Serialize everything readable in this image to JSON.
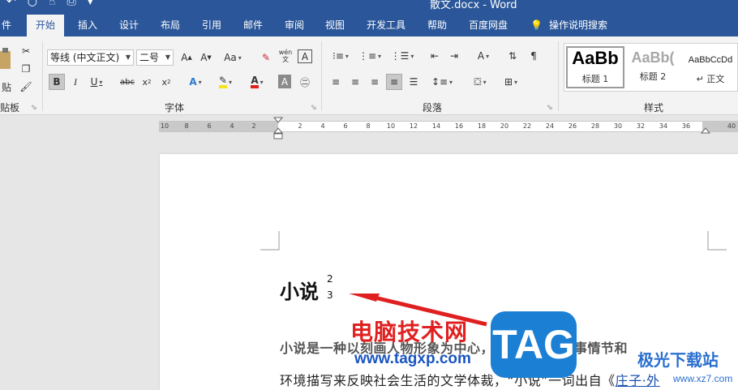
{
  "window": {
    "title": "散文.docx  -  Word"
  },
  "tabs": [
    {
      "label": "件"
    },
    {
      "label": "开始"
    },
    {
      "label": "插入"
    },
    {
      "label": "设计"
    },
    {
      "label": "布局"
    },
    {
      "label": "引用"
    },
    {
      "label": "邮件"
    },
    {
      "label": "审阅"
    },
    {
      "label": "视图"
    },
    {
      "label": "开发工具"
    },
    {
      "label": "帮助"
    },
    {
      "label": "百度网盘"
    },
    {
      "label": "操作说明搜索"
    }
  ],
  "ribbon": {
    "clipboard": {
      "paste_label": "贴",
      "group_label": "贴板"
    },
    "font": {
      "font_name": "等线 (中文正文)",
      "font_size": "二号",
      "group_label": "字体",
      "case_label": "Aa",
      "pinyin_top": "wén",
      "pinyin_bottom": "文"
    },
    "paragraph": {
      "group_label": "段落"
    },
    "styles": {
      "group_label": "样式",
      "items": [
        {
          "sample": "AaBb",
          "name": "标题 1"
        },
        {
          "sample": "AaBb(",
          "name": "标题 2"
        },
        {
          "sample": "AaBbCcDd",
          "name": "正文"
        }
      ]
    }
  },
  "ruler": {
    "ticks": [
      "10",
      "8",
      "6",
      "4",
      "2",
      "2",
      "4",
      "6",
      "8",
      "10",
      "12",
      "14",
      "16",
      "18",
      "20",
      "22",
      "24",
      "26",
      "28",
      "30",
      "32",
      "34",
      "36",
      "40"
    ]
  },
  "document": {
    "heading": "小说",
    "heading_super": "2",
    "heading_sub": "3",
    "line1": "小说是一种以刻画人物形象为中心，通过完整的故事情节和",
    "line2_prefix": "环境描写来反映社会生活的文学体裁，“小说”一词出自《",
    "line2_link": "庄子·外"
  },
  "watermarks": {
    "title": "电脑技术网",
    "url": "www.tagxp.com",
    "logo": "TAG",
    "site2": "极光下载站",
    "site2_url": "www.xz7.com"
  },
  "colors": {
    "brand": "#2b579a",
    "watermark_red": "#e02020",
    "watermark_blue": "#1a55c0"
  }
}
